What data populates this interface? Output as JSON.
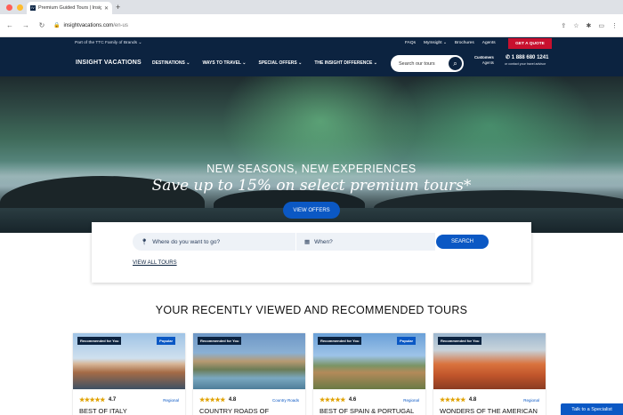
{
  "browser": {
    "tab_title": "Premium Guided Tours | Insig",
    "tab_favicon": "IV",
    "address_host": "insightvacations.com",
    "address_path": "/en-us"
  },
  "header": {
    "family_text": "Part of the TTC Family of Brands",
    "top_links": [
      "FAQs",
      "MyInsight",
      "Brochures",
      "Agents"
    ],
    "quote_button": "GET A QUOTE",
    "logo": "INSIGHT VACATIONS",
    "nav": [
      "DESTINATIONS",
      "WAYS TO TRAVEL",
      "SPECIAL OFFERS",
      "THE INSIGHT DIFFERENCE"
    ],
    "search_placeholder": "Search our tours",
    "customers_label": "Customers",
    "agents_label": "Agents",
    "phone": "1 888 680 1241",
    "phone_sub": "or contact your travel advisor"
  },
  "hero": {
    "headline": "NEW SEASONS, NEW EXPERIENCES",
    "tagline": "Save up to 15% on select premium tours*",
    "cta": "VIEW OFFERS"
  },
  "search_panel": {
    "where_placeholder": "Where do you want to go?",
    "when_placeholder": "When?",
    "search_button": "SEARCH",
    "view_all": "VIEW ALL TOURS"
  },
  "section_title": "YOUR RECENTLY VIEWED AND RECOMMENDED TOURS",
  "cards": [
    {
      "badge": "Recommended for You",
      "tag": "Popular",
      "rating": "4.7",
      "category": "Regional",
      "title": "BEST OF ITALY"
    },
    {
      "badge": "Recommended for You",
      "tag": "",
      "rating": "4.8",
      "category": "Country Roads",
      "title": "COUNTRY ROADS OF"
    },
    {
      "badge": "Recommended for You",
      "tag": "Popular",
      "rating": "4.6",
      "category": "Regional",
      "title": "BEST OF SPAIN & PORTUGAL"
    },
    {
      "badge": "Recommended for You",
      "tag": "",
      "rating": "4.8",
      "category": "Regional",
      "title": "WONDERS OF THE AMERICAN"
    }
  ],
  "chat": {
    "label": "Talk to a Specialist"
  }
}
